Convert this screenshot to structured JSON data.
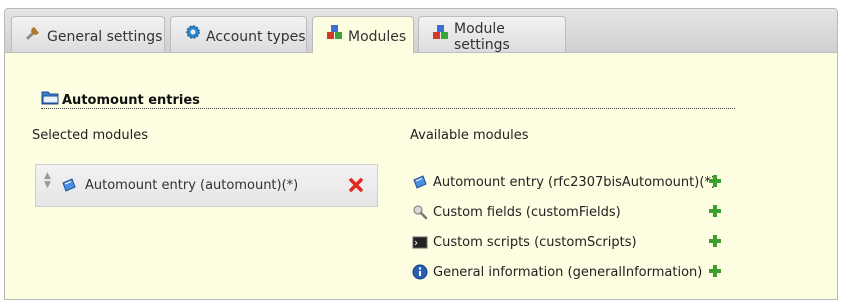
{
  "tabs": [
    {
      "label": "General settings",
      "icon": "wrench-icon"
    },
    {
      "label": "Account types",
      "icon": "gear-icon"
    },
    {
      "label": "Modules",
      "icon": "modules-icon",
      "active": true
    },
    {
      "label": "Module settings",
      "icon": "modules-icon"
    }
  ],
  "section": {
    "title": "Automount entries",
    "icon": "folder-icon"
  },
  "selected": {
    "heading": "Selected modules",
    "items": [
      {
        "label": "Automount entry (automount)(*)",
        "icon": "automount-icon"
      }
    ]
  },
  "available": {
    "heading": "Available modules",
    "items": [
      {
        "label": "Automount entry (rfc2307bisAutomount)(*)",
        "icon": "automount-icon"
      },
      {
        "label": "Custom fields (customFields)",
        "icon": "custom-fields-icon"
      },
      {
        "label": "Custom scripts (customScripts)",
        "icon": "terminal-icon"
      },
      {
        "label": "General information (generalInformation)",
        "icon": "info-icon"
      }
    ]
  },
  "colors": {
    "panel_bg": "#fdfde2",
    "remove": "#e0281e",
    "add": "#3ca02a"
  }
}
